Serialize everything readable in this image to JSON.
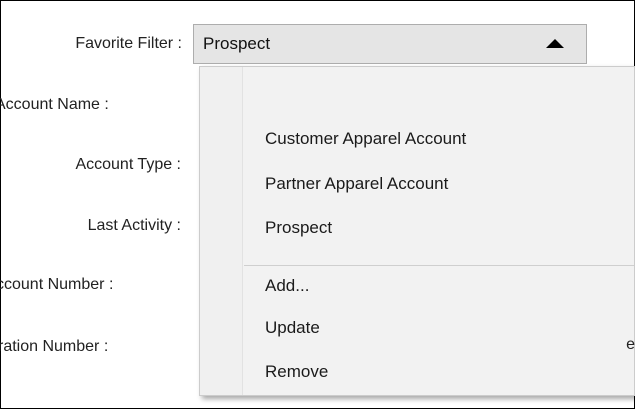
{
  "form": {
    "labels": {
      "favorite_filter": "Favorite Filter :",
      "account_name": "Account Name :",
      "account_type": "Account Type :",
      "last_activity": "Last Activity :",
      "account_number": "ccount Number :",
      "registration_number": "ration Number :"
    },
    "right_edge_fragment": "e"
  },
  "favorite_filter": {
    "selected_value": "Prospect",
    "expanded": true
  },
  "dropdown": {
    "filters": [
      "Customer Apparel Account",
      "Partner Apparel Account",
      "Prospect"
    ],
    "actions": [
      "Add...",
      "Update",
      "Remove"
    ]
  },
  "icons": {
    "combo_arrow": "triangle-up-icon"
  }
}
